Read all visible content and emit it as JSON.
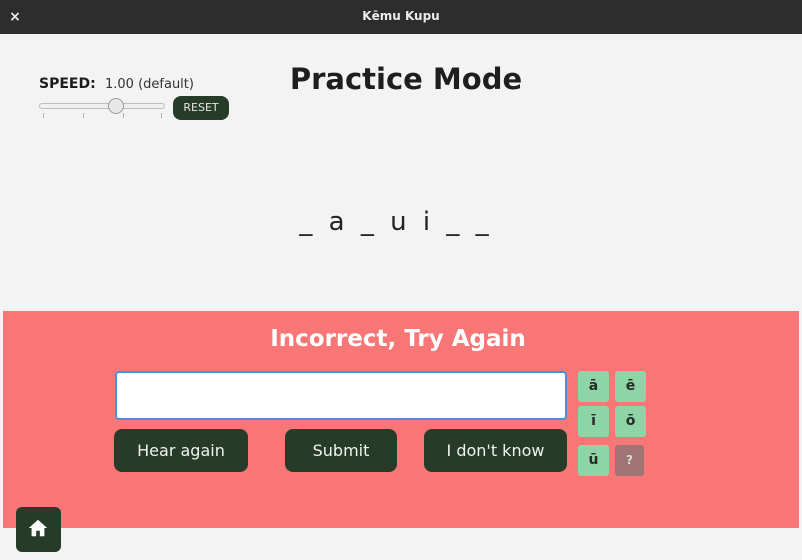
{
  "window": {
    "title": "Kēmu Kupu",
    "close_glyph": "×"
  },
  "speed": {
    "label": "SPEED:",
    "value": "1.00 (default)",
    "slider_fraction": 0.63,
    "reset_label": "RESET"
  },
  "page": {
    "title": "Practice Mode"
  },
  "puzzle": {
    "pattern": "_ a _ u i _ _"
  },
  "feedback": {
    "message": "Incorrect, Try Again",
    "background_color": "#f87676",
    "answer_value": "",
    "answer_placeholder": ""
  },
  "buttons": {
    "hear_again": "Hear again",
    "submit": "Submit",
    "dont_know": "I don't know"
  },
  "macrons": [
    "ā",
    "ē",
    "ī",
    "ō",
    "ū"
  ],
  "help_label": "?",
  "colors": {
    "button_dark": "#263b28",
    "macron_key": "#8ed4a6",
    "help_key": "#a07474"
  },
  "icons": {
    "home": "home-icon",
    "close": "close-icon"
  }
}
